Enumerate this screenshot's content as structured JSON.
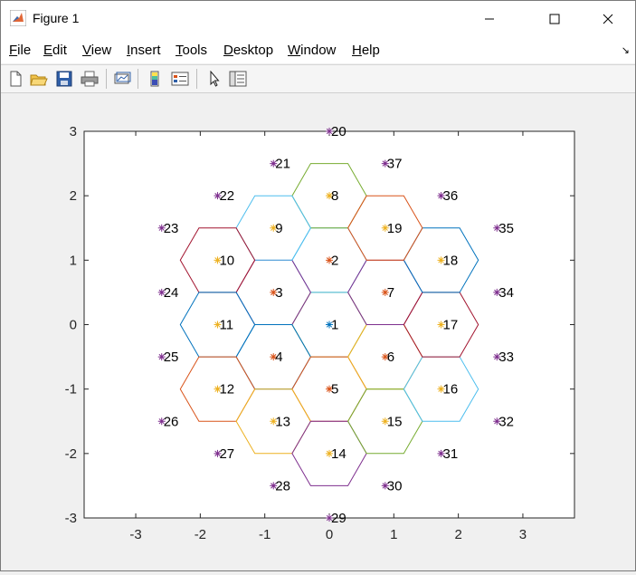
{
  "window": {
    "title": "Figure 1"
  },
  "menu": {
    "items": [
      {
        "label": "File",
        "u": "F",
        "rest": "ile"
      },
      {
        "label": "Edit",
        "u": "E",
        "rest": "dit"
      },
      {
        "label": "View",
        "u": "V",
        "rest": "iew"
      },
      {
        "label": "Insert",
        "u": "I",
        "rest": "nsert"
      },
      {
        "label": "Tools",
        "u": "T",
        "rest": "ools"
      },
      {
        "label": "Desktop",
        "u": "D",
        "rest": "esktop"
      },
      {
        "label": "Window",
        "u": "W",
        "rest": "indow"
      },
      {
        "label": "Help",
        "u": "H",
        "rest": "elp"
      }
    ]
  },
  "toolbar": {
    "buttons": [
      "new-figure",
      "open-file",
      "save",
      "print",
      "link-plot",
      "insert-colorbar",
      "insert-legend",
      "edit-plot",
      "open-property-inspector"
    ]
  },
  "chart_data": {
    "type": "scatter",
    "title": "",
    "xlabel": "",
    "ylabel": "",
    "xlim": [
      -3.8,
      3.8
    ],
    "ylim": [
      -3,
      3
    ],
    "xticks": [
      -3,
      -2,
      -1,
      0,
      1,
      2,
      3
    ],
    "yticks": [
      -3,
      -2,
      -1,
      0,
      1,
      2,
      3
    ],
    "marker": "*",
    "grid": false,
    "points": [
      {
        "id": "1",
        "x": 0,
        "y": 0,
        "color": "#0072bd"
      },
      {
        "id": "2",
        "x": 0,
        "y": 1,
        "color": "#d95319"
      },
      {
        "id": "3",
        "x": -0.866,
        "y": 0.5,
        "color": "#d95319"
      },
      {
        "id": "4",
        "x": -0.866,
        "y": -0.5,
        "color": "#d95319"
      },
      {
        "id": "5",
        "x": 0,
        "y": -1,
        "color": "#d95319"
      },
      {
        "id": "6",
        "x": 0.866,
        "y": -0.5,
        "color": "#d95319"
      },
      {
        "id": "7",
        "x": 0.866,
        "y": 0.5,
        "color": "#d95319"
      },
      {
        "id": "8",
        "x": 0,
        "y": 2,
        "color": "#edb120"
      },
      {
        "id": "9",
        "x": -0.866,
        "y": 1.5,
        "color": "#edb120"
      },
      {
        "id": "10",
        "x": -1.732,
        "y": 1,
        "color": "#edb120"
      },
      {
        "id": "11",
        "x": -1.732,
        "y": 0,
        "color": "#edb120"
      },
      {
        "id": "12",
        "x": -1.732,
        "y": -1,
        "color": "#edb120"
      },
      {
        "id": "13",
        "x": -0.866,
        "y": -1.5,
        "color": "#edb120"
      },
      {
        "id": "14",
        "x": 0,
        "y": -2,
        "color": "#edb120"
      },
      {
        "id": "15",
        "x": 0.866,
        "y": -1.5,
        "color": "#edb120"
      },
      {
        "id": "16",
        "x": 1.732,
        "y": -1,
        "color": "#edb120"
      },
      {
        "id": "17",
        "x": 1.732,
        "y": 0,
        "color": "#edb120"
      },
      {
        "id": "18",
        "x": 1.732,
        "y": 1,
        "color": "#edb120"
      },
      {
        "id": "19",
        "x": 0.866,
        "y": 1.5,
        "color": "#edb120"
      },
      {
        "id": "20",
        "x": 0,
        "y": 3,
        "color": "#7e2f8e"
      },
      {
        "id": "21",
        "x": -0.866,
        "y": 2.5,
        "color": "#7e2f8e"
      },
      {
        "id": "22",
        "x": -1.732,
        "y": 2,
        "color": "#7e2f8e"
      },
      {
        "id": "23",
        "x": -2.598,
        "y": 1.5,
        "color": "#7e2f8e"
      },
      {
        "id": "24",
        "x": -2.598,
        "y": 0.5,
        "color": "#7e2f8e"
      },
      {
        "id": "25",
        "x": -2.598,
        "y": -0.5,
        "color": "#7e2f8e"
      },
      {
        "id": "26",
        "x": -2.598,
        "y": -1.5,
        "color": "#7e2f8e"
      },
      {
        "id": "27",
        "x": -1.732,
        "y": -2,
        "color": "#7e2f8e"
      },
      {
        "id": "28",
        "x": -0.866,
        "y": -2.5,
        "color": "#7e2f8e"
      },
      {
        "id": "29",
        "x": 0,
        "y": -3,
        "color": "#7e2f8e"
      },
      {
        "id": "30",
        "x": 0.866,
        "y": -2.5,
        "color": "#7e2f8e"
      },
      {
        "id": "31",
        "x": 1.732,
        "y": -2,
        "color": "#7e2f8e"
      },
      {
        "id": "32",
        "x": 2.598,
        "y": -1.5,
        "color": "#7e2f8e"
      },
      {
        "id": "33",
        "x": 2.598,
        "y": -0.5,
        "color": "#7e2f8e"
      },
      {
        "id": "34",
        "x": 2.598,
        "y": 0.5,
        "color": "#7e2f8e"
      },
      {
        "id": "35",
        "x": 2.598,
        "y": 1.5,
        "color": "#7e2f8e"
      },
      {
        "id": "36",
        "x": 1.732,
        "y": 2,
        "color": "#7e2f8e"
      },
      {
        "id": "37",
        "x": 0.866,
        "y": 2.5,
        "color": "#7e2f8e"
      }
    ],
    "hexagons": [
      {
        "cx": 0,
        "cy": 0,
        "r": 0.577,
        "color": "#77ac30"
      },
      {
        "cx": 0,
        "cy": 1,
        "r": 0.577,
        "color": "#4dbeee"
      },
      {
        "cx": -0.866,
        "cy": 0.5,
        "r": 0.577,
        "color": "#7e2f8e"
      },
      {
        "cx": -0.866,
        "cy": -0.5,
        "r": 0.577,
        "color": "#0072bd"
      },
      {
        "cx": 0,
        "cy": -1,
        "r": 0.577,
        "color": "#d95319"
      },
      {
        "cx": 0.866,
        "cy": -0.5,
        "r": 0.577,
        "color": "#edb120"
      },
      {
        "cx": 0.866,
        "cy": 0.5,
        "r": 0.577,
        "color": "#7e2f8e"
      },
      {
        "cx": 0,
        "cy": 2,
        "r": 0.577,
        "color": "#77ac30"
      },
      {
        "cx": -0.866,
        "cy": 1.5,
        "r": 0.577,
        "color": "#4dbeee"
      },
      {
        "cx": -1.732,
        "cy": 1,
        "r": 0.577,
        "color": "#a2142f"
      },
      {
        "cx": -1.732,
        "cy": 0,
        "r": 0.577,
        "color": "#0072bd"
      },
      {
        "cx": -1.732,
        "cy": -1,
        "r": 0.577,
        "color": "#d95319"
      },
      {
        "cx": -0.866,
        "cy": -1.5,
        "r": 0.577,
        "color": "#edb120"
      },
      {
        "cx": 0,
        "cy": -2,
        "r": 0.577,
        "color": "#7e2f8e"
      },
      {
        "cx": 0.866,
        "cy": -1.5,
        "r": 0.577,
        "color": "#77ac30"
      },
      {
        "cx": 1.732,
        "cy": -1,
        "r": 0.577,
        "color": "#4dbeee"
      },
      {
        "cx": 1.732,
        "cy": 0,
        "r": 0.577,
        "color": "#a2142f"
      },
      {
        "cx": 1.732,
        "cy": 1,
        "r": 0.577,
        "color": "#0072bd"
      },
      {
        "cx": 0.866,
        "cy": 1.5,
        "r": 0.577,
        "color": "#d95319"
      }
    ]
  }
}
